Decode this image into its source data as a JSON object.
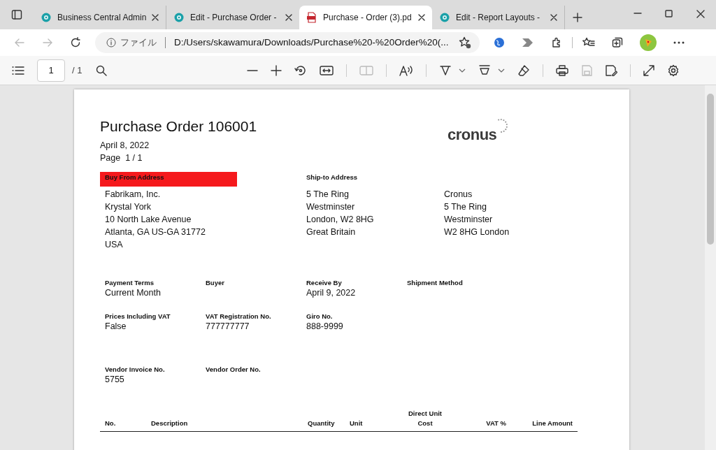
{
  "tabs": [
    {
      "label": "Business Central Admin",
      "kind": "web",
      "selected": false
    },
    {
      "label": "Edit - Purchase Order -",
      "kind": "web",
      "selected": false
    },
    {
      "label": "Purchase - Order (3).pd",
      "kind": "pdf",
      "selected": true
    },
    {
      "label": "Edit - Report Layouts -",
      "kind": "web",
      "selected": false
    }
  ],
  "address_bar": {
    "scheme_label": "ファイル",
    "url": "D:/Users/skawamura/Downloads/Purchase%20-%20Order%20(..."
  },
  "pdf_toolbar": {
    "page": "1",
    "page_total": "/ 1"
  },
  "document": {
    "title": "Purchase Order 106001",
    "date": "April 8, 2022",
    "page": "Page  1 / 1",
    "logo": "cronus",
    "buy_from": {
      "heading": "Buy From Address",
      "lines": [
        "Fabrikam, Inc.",
        "Krystal York",
        "10 North Lake Avenue",
        "Atlanta, GA US-GA 31772",
        "USA"
      ]
    },
    "ship_to": {
      "heading": "Ship-to Address",
      "lines": [
        "5 The Ring",
        "Westminster",
        "London, W2 8HG",
        "Great Britain"
      ],
      "company_lines": [
        "Cronus",
        "5 The Ring",
        "Westminster",
        "W2 8HG London"
      ]
    },
    "field_rows": [
      [
        {
          "label": "Payment Terms",
          "value": "Current Month"
        },
        {
          "label": "Buyer"
        },
        {
          "label": "Receive By",
          "value": "April 9, 2022"
        },
        {
          "label": "Shipment Method"
        }
      ],
      [
        {
          "label": "Prices Including VAT",
          "value": "False"
        },
        {
          "label": "VAT Registration No.",
          "value": "777777777"
        },
        {
          "label": "Giro No.",
          "value": "888-9999"
        }
      ],
      [
        {
          "label": "Vendor Invoice No.",
          "value": "5755"
        },
        {
          "label": "Vendor Order No."
        }
      ]
    ],
    "table_columns": [
      "No.",
      "Description",
      "Quantity",
      "Unit",
      "Direct Unit Cost",
      "VAT %",
      "Line Amount"
    ]
  }
}
